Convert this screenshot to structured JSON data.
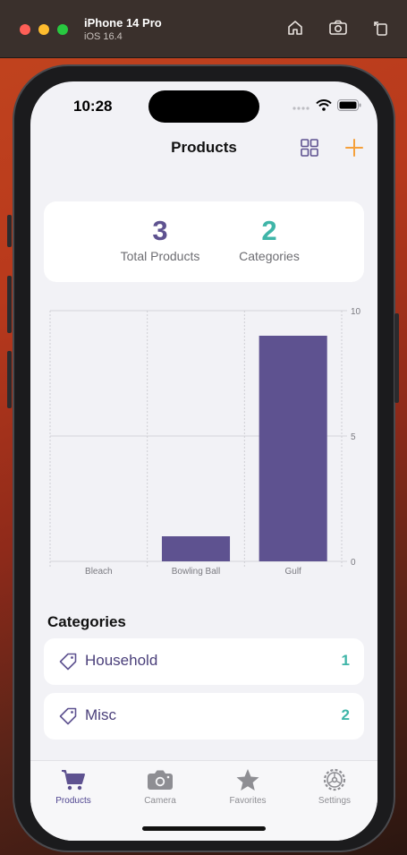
{
  "simulator": {
    "device_name": "iPhone 14 Pro",
    "os_version": "iOS 16.4",
    "tools": [
      "home-icon",
      "screenshot-icon",
      "rotate-icon"
    ]
  },
  "status_bar": {
    "time": "10:28"
  },
  "nav": {
    "title": "Products",
    "left_icon": "grid-icon",
    "right_icon": "plus-icon"
  },
  "summary": {
    "total_products": "3",
    "total_products_label": "Total Products",
    "categories_count": "2",
    "categories_label": "Categories"
  },
  "colors": {
    "accent_purple": "#5e5290",
    "accent_teal": "#3fb5a8",
    "accent_orange": "#f5a03a"
  },
  "chart_data": {
    "type": "bar",
    "categories": [
      "Bleach",
      "Bowling Ball",
      "Gulf"
    ],
    "values": [
      0,
      1,
      9
    ],
    "ylim": [
      0,
      10
    ],
    "yticks": [
      "0",
      "5",
      "10"
    ],
    "grid": true,
    "y_axis_position": "right"
  },
  "categories_section": {
    "title": "Categories",
    "items": [
      {
        "name": "Household",
        "count": "1"
      },
      {
        "name": "Misc",
        "count": "2"
      }
    ]
  },
  "tabbar": {
    "items": [
      {
        "label": "Products",
        "icon": "cart-icon",
        "active": true
      },
      {
        "label": "Camera",
        "icon": "camera-icon",
        "active": false
      },
      {
        "label": "Favorites",
        "icon": "star-icon",
        "active": false
      },
      {
        "label": "Settings",
        "icon": "gear-icon",
        "active": false
      }
    ]
  }
}
